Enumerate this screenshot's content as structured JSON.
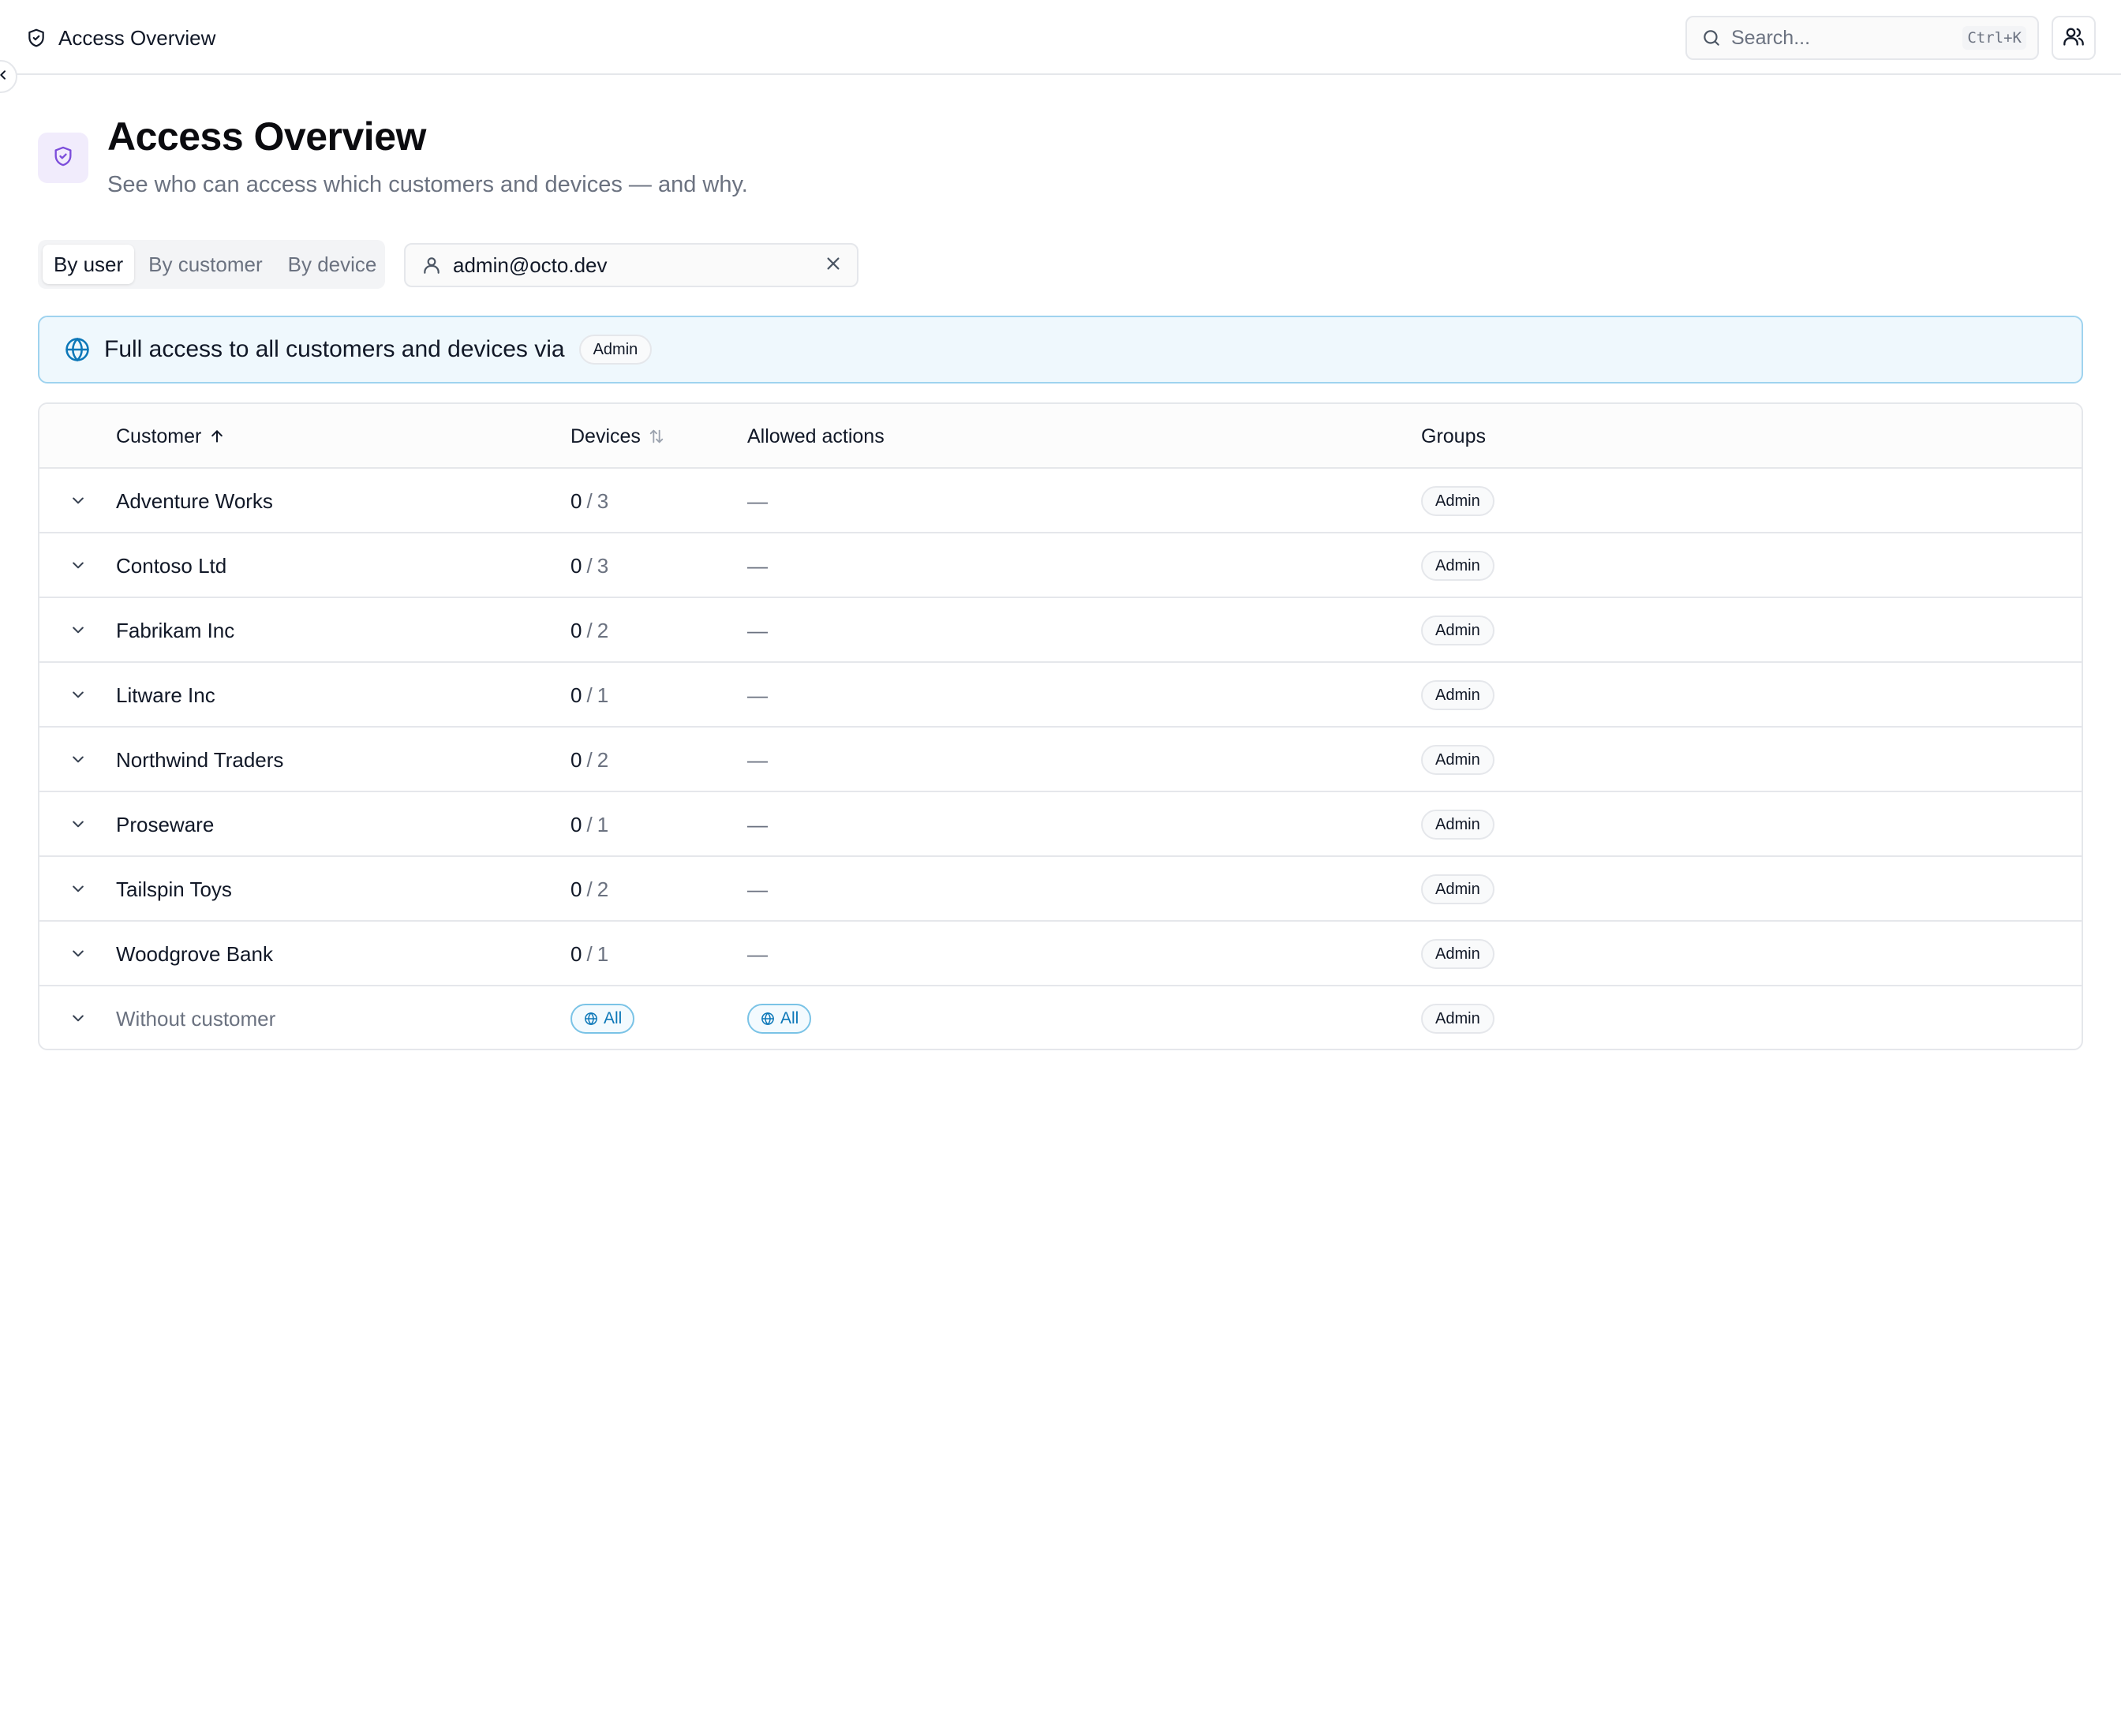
{
  "topbar": {
    "title": "Access Overview",
    "search_placeholder": "Search...",
    "search_shortcut": "Ctrl+K"
  },
  "header": {
    "title": "Access Overview",
    "subtitle": "See who can access which customers and devices — and why."
  },
  "tabs": [
    {
      "label": "By user",
      "active": true
    },
    {
      "label": "By customer",
      "active": false
    },
    {
      "label": "By device",
      "active": false
    }
  ],
  "user_filter": {
    "value": "admin@octo.dev"
  },
  "banner": {
    "text": "Full access to all customers and devices via",
    "badge": "Admin"
  },
  "table": {
    "columns": {
      "customer": "Customer",
      "devices": "Devices",
      "actions": "Allowed actions",
      "groups": "Groups"
    },
    "rows": [
      {
        "customer": "Adventure Works",
        "devices_accessible": "0",
        "devices_total": "3",
        "actions": "—",
        "group": "Admin"
      },
      {
        "customer": "Contoso Ltd",
        "devices_accessible": "0",
        "devices_total": "3",
        "actions": "—",
        "group": "Admin"
      },
      {
        "customer": "Fabrikam Inc",
        "devices_accessible": "0",
        "devices_total": "2",
        "actions": "—",
        "group": "Admin"
      },
      {
        "customer": "Litware Inc",
        "devices_accessible": "0",
        "devices_total": "1",
        "actions": "—",
        "group": "Admin"
      },
      {
        "customer": "Northwind Traders",
        "devices_accessible": "0",
        "devices_total": "2",
        "actions": "—",
        "group": "Admin"
      },
      {
        "customer": "Proseware",
        "devices_accessible": "0",
        "devices_total": "1",
        "actions": "—",
        "group": "Admin"
      },
      {
        "customer": "Tailspin Toys",
        "devices_accessible": "0",
        "devices_total": "2",
        "actions": "—",
        "group": "Admin"
      },
      {
        "customer": "Woodgrove Bank",
        "devices_accessible": "0",
        "devices_total": "1",
        "actions": "—",
        "group": "Admin"
      }
    ],
    "without_customer": {
      "customer": "Without customer",
      "devices": "All",
      "actions": "All",
      "group": "Admin"
    }
  },
  "colors": {
    "accent_purple": "#7c4ddb",
    "accent_blue": "#0c77b8",
    "banner_bg": "#eff8fd",
    "banner_border": "#9fd3ef",
    "border": "#e5e7eb"
  },
  "icons": {
    "breadcrumb": "shield-check-icon",
    "search": "search-icon",
    "users": "users-icon",
    "collapse": "chevron-left-icon",
    "header": "shield-check-icon",
    "user_filter": "user-icon",
    "clear": "close-icon",
    "banner": "globe-icon",
    "row_expand": "chevron-down-icon",
    "sort_customer": "arrow-up-icon",
    "sort_devices": "sort-icon",
    "all_pill": "globe-icon"
  }
}
